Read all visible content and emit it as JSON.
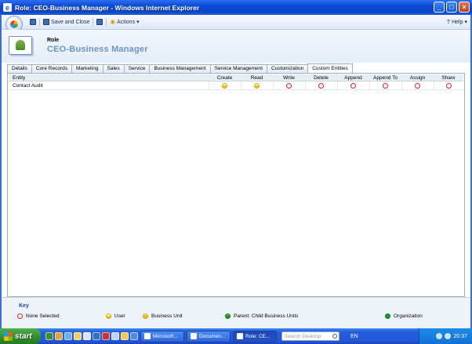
{
  "window": {
    "title": "Role: CEO-Business Manager - Windows Internet Explorer",
    "buttons": [
      "_",
      "□",
      "×"
    ]
  },
  "toolbar": {
    "save_close_label": "Save and Close",
    "actions_label": "Actions",
    "help_label": "Help"
  },
  "header": {
    "label": "Role",
    "name": "CEO-Business Manager"
  },
  "tabs": [
    {
      "label": "Details",
      "active": false
    },
    {
      "label": "Core Records",
      "active": false
    },
    {
      "label": "Marketing",
      "active": false
    },
    {
      "label": "Sales",
      "active": false
    },
    {
      "label": "Service",
      "active": false
    },
    {
      "label": "Business Management",
      "active": false
    },
    {
      "label": "Service Management",
      "active": false
    },
    {
      "label": "Customization",
      "active": false
    },
    {
      "label": "Custom Entities",
      "active": true
    }
  ],
  "grid": {
    "columns": [
      "Entity",
      "Create",
      "Read",
      "Write",
      "Delete",
      "Append",
      "Append To",
      "Assign",
      "Share"
    ],
    "rows": [
      {
        "entity": "Contact Audit",
        "levels": [
          "user",
          "user",
          "none",
          "none",
          "none",
          "none",
          "none",
          "none"
        ]
      }
    ]
  },
  "key": {
    "title": "Key",
    "items": [
      {
        "level": "none",
        "label": "None Selected"
      },
      {
        "level": "user",
        "label": "User"
      },
      {
        "level": "business-unit",
        "label": "Business Unit"
      },
      {
        "level": "parent",
        "label": "Parent: Child Business Units"
      },
      {
        "level": "organization",
        "label": "Organization"
      }
    ]
  },
  "taskbar": {
    "start_label": "start",
    "tasks": [
      {
        "label": "Microsoft...",
        "active": false
      },
      {
        "label": "Documen...",
        "active": false
      },
      {
        "label": "Role: CE...",
        "active": true
      }
    ],
    "search_placeholder": "Search Desktop",
    "language": "EN",
    "clock": "20:37"
  }
}
